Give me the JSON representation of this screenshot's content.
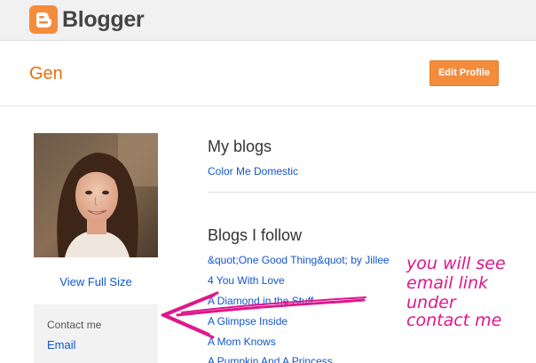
{
  "header": {
    "logo_text": "Blogger",
    "logo_icon": "blogger-b-icon",
    "brand_color": "#f48c3c"
  },
  "profile": {
    "name": "Gen",
    "edit_label": "Edit Profile",
    "view_full_size": "View Full Size"
  },
  "contact": {
    "label": "Contact me",
    "email_link": "Email"
  },
  "my_blogs": {
    "title": "My blogs",
    "items": [
      "Color Me Domestic"
    ]
  },
  "blogs_follow": {
    "title": "Blogs I follow",
    "items": [
      "&quot;One Good Thing&quot; by Jillee",
      "4 You With Love",
      "A Diamond in the Stuff",
      "A Glimpse Inside",
      "A Mom Knows",
      "A Pumpkin And A Princess"
    ]
  },
  "annotation": {
    "lines": [
      "you will see",
      "email link",
      "under",
      "contact me"
    ],
    "color": "#e0168c"
  },
  "colors": {
    "link": "#1155cc",
    "name": "#e8720c"
  }
}
